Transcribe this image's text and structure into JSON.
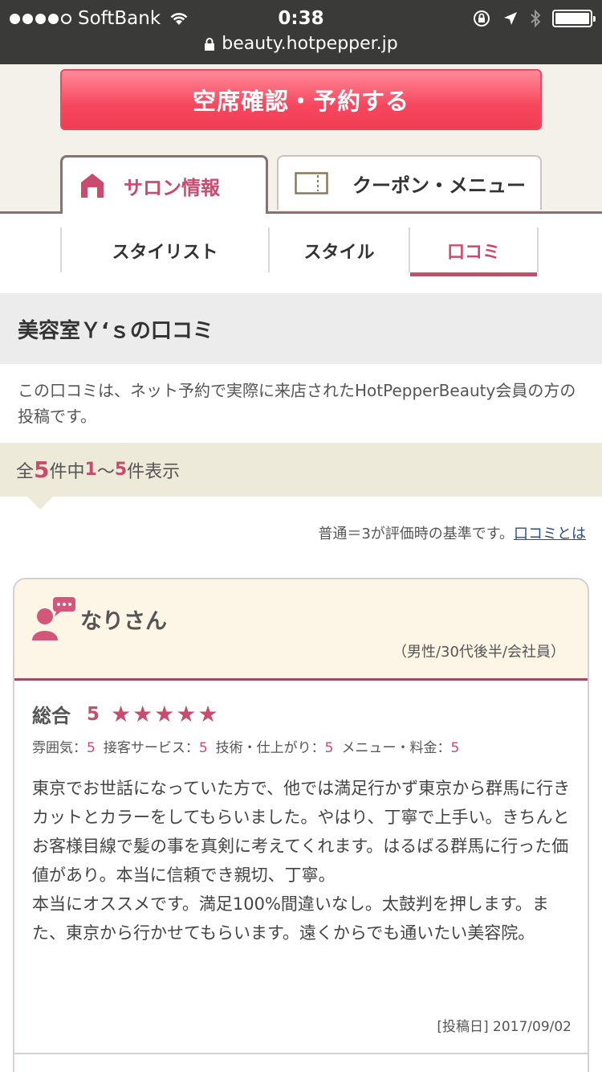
{
  "status_bar": {
    "carrier": "SoftBank",
    "time": "0:38",
    "url": "beauty.hotpepper.jp"
  },
  "reserve": {
    "label": "空席確認・予約する"
  },
  "tabs": [
    {
      "label": "サロン情報",
      "active": true
    },
    {
      "label": "クーポン・メニュー",
      "active": false
    }
  ],
  "subtabs": [
    {
      "label": "スタイリスト",
      "active": false
    },
    {
      "label": "スタイル",
      "active": false
    },
    {
      "label": "口コミ",
      "active": true
    }
  ],
  "section": {
    "title": "美容室Ｙ‘ｓの口コミ",
    "description": "この口コミは、ネット予約で実際に来店されたHotPepperBeauty会員の方の投稿です。"
  },
  "count": {
    "prefix": "全",
    "total": "5",
    "mid": "件中",
    "from": "1",
    "tilde": "～",
    "to": "5",
    "suffix": "件表示"
  },
  "note": {
    "text": "普通＝3が評価時の基準です。",
    "link": "口コミとは"
  },
  "review": {
    "reviewer": "なりさん",
    "meta": "（男性/30代後半/会社員）",
    "overall_label": "総合",
    "overall_score": "5",
    "stars": 5,
    "subscores": [
      {
        "label": "雰囲気：",
        "value": "5"
      },
      {
        "label": "接客サービス：",
        "value": "5"
      },
      {
        "label": "技術・仕上がり：",
        "value": "5"
      },
      {
        "label": "メニュー・料金：",
        "value": "5"
      }
    ],
    "body": "東京でお世話になっていた方で、他では満足行かず東京から群馬に行きカットとカラーをしてもらいました。やはり、丁寧で上手い。きちんとお客様目線で髪の事を真剣に考えてくれます。はるばる群馬に行った価値があり。本当に信頼でき親切、丁寧。\n本当にオススメです。満足100%間違いなし。太鼓判を押します。また、東京から行かせてもらいます。遠くからでも通いたい美容院。",
    "post_date": "[投稿日] 2017/09/02"
  },
  "colors": {
    "accent": "#c94c6e",
    "reserve_button": "#f7475e",
    "status_bar": "#3a3a38",
    "header_bg": "#f3f1e9"
  }
}
